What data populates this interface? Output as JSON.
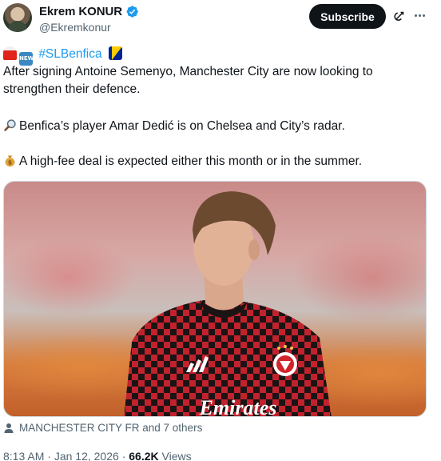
{
  "author": {
    "display_name": "Ekrem KONUR",
    "handle": "@Ekremkonur"
  },
  "actions": {
    "subscribe_label": "Subscribe",
    "grok_icon": "grok-icon",
    "more_icon": "more-dots-icon"
  },
  "post": {
    "hashtag": "#SLBenfica",
    "paragraph1": "After signing Antoine Semenyo, Manchester City are now looking to strengthen their defence.",
    "paragraph2": "Benfica’s player Amar Dedić is on Chelsea and City’s radar.",
    "paragraph3": "A high-fee deal is expected either this month or in the summer.",
    "emojis": [
      "siren",
      "new-badge",
      "bosnia-flag",
      "magnifying-glass",
      "money-bag"
    ],
    "image": {
      "description_label": "Player photo",
      "shirt_text": "Emirates"
    }
  },
  "engagement": {
    "liked_by": "MANCHESTER CITY FR and 7 others"
  },
  "meta": {
    "time": "8:13 AM",
    "separator": "·",
    "date": "Jan 12, 2026",
    "views_count": "66.2K",
    "views_label": "Views"
  },
  "colors": {
    "link": "#1d9bf0",
    "text": "#0f1419",
    "secondary": "#536471",
    "verified": "#1d9bf0"
  }
}
